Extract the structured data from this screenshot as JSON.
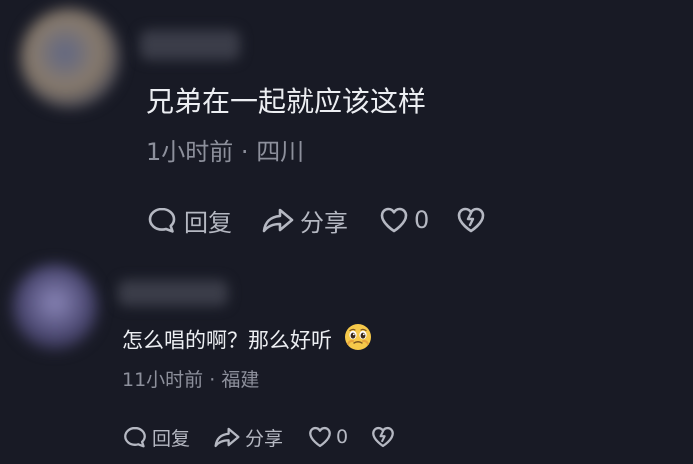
{
  "comments": [
    {
      "text": "兄弟在一起就应该这样",
      "time": "1小时前",
      "location": "四川",
      "reply_label": "回复",
      "share_label": "分享",
      "like_count": "0"
    },
    {
      "text": "怎么唱的啊？那么好听",
      "emoji": "pleading-face-emoji",
      "time": "11小时前",
      "location": "福建",
      "reply_label": "回复",
      "share_label": "分享",
      "like_count": "0"
    }
  ],
  "colors": {
    "background": "#181a25",
    "text": "#eceef2",
    "meta": "#8d909c",
    "actions": "#b5b8c2"
  },
  "icons": [
    "comment-bubble-icon",
    "share-arrow-icon",
    "heart-icon",
    "broken-heart-icon"
  ]
}
